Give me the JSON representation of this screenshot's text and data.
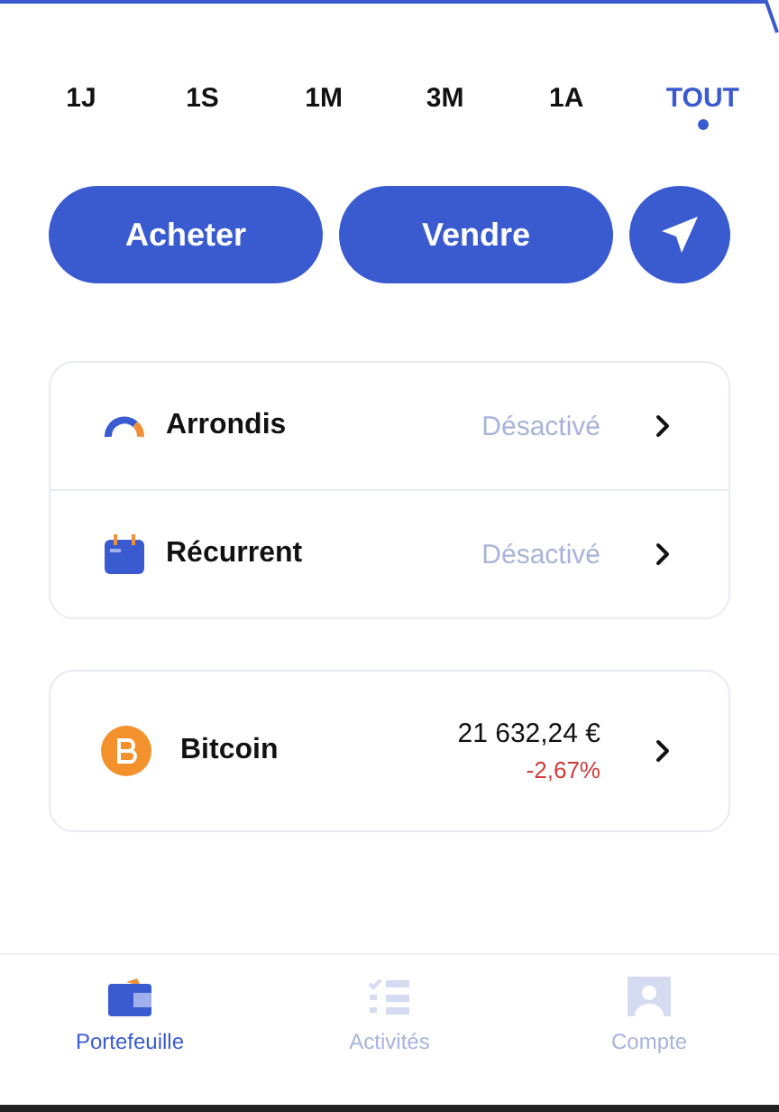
{
  "periods": [
    {
      "label": "1J",
      "selected": false
    },
    {
      "label": "1S",
      "selected": false
    },
    {
      "label": "1M",
      "selected": false
    },
    {
      "label": "3M",
      "selected": false
    },
    {
      "label": "1A",
      "selected": false
    },
    {
      "label": "TOUT",
      "selected": true
    }
  ],
  "actions": [
    "Acheter",
    "Vendre"
  ],
  "settings": [
    {
      "label": "Arrondis",
      "status": "Désactivé",
      "disabled": true
    },
    {
      "label": "Récurrent",
      "status": "Désactivé",
      "disabled": true
    }
  ],
  "assets": [
    {
      "name": "Bitcoin",
      "value": "21 632,24 €",
      "change": "-2,67%",
      "negative": true
    }
  ],
  "tab_bar": [
    {
      "label": "Portefeuille",
      "selected": true
    },
    {
      "label": "Activités",
      "selected": false
    },
    {
      "label": "Compte",
      "selected": false
    }
  ]
}
